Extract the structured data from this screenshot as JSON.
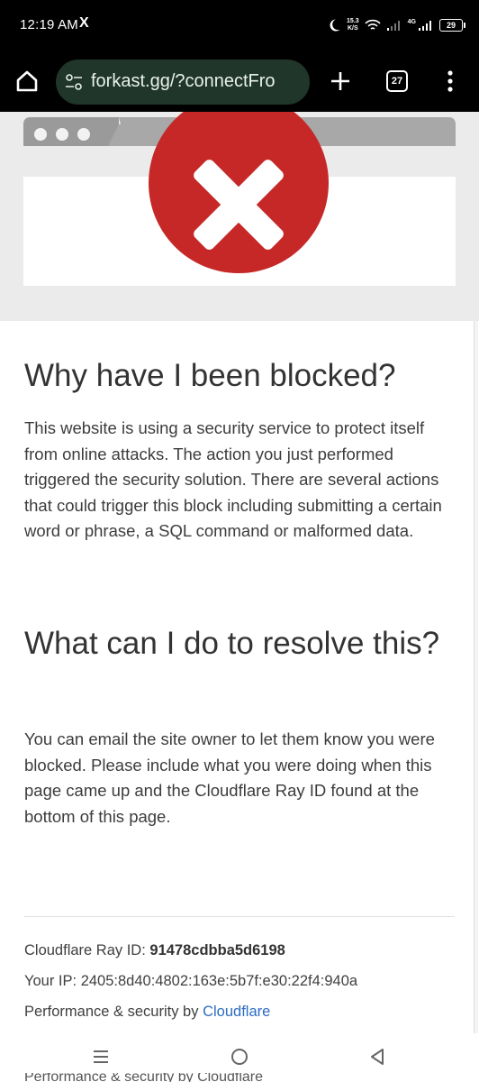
{
  "status_bar": {
    "time": "12:19 AM",
    "x_icon": "X",
    "net_speed_value": "15.3",
    "net_speed_unit": "K/S",
    "network_type": "4G",
    "battery": "29"
  },
  "browser": {
    "url": "forkast.gg/?connectFro",
    "tab_count": "27",
    "icons": [
      "home-icon",
      "site-settings-icon",
      "new-tab-icon",
      "tab-switcher-icon",
      "overflow-menu-icon"
    ]
  },
  "page": {
    "blocked_heading": "Why have I been blocked?",
    "blocked_body": "This website is using a security service to protect itself from online attacks. The action you just performed triggered the security solution. There are several actions that could trigger this block including submitting a certain word or phrase, a SQL command or malformed data.",
    "resolve_heading": "What can I do to resolve this?",
    "resolve_body": "You can email the site owner to let them know you were blocked. Please include what you were doing when this page came up and the Cloudflare Ray ID found at the bottom of this page.",
    "ray_label": "Cloudflare Ray ID:",
    "ray_id": "91478cdbba5d6198",
    "ip_label": "Your IP:",
    "ip_value": "2405:8d40:4802:163e:5b7f:e30:22f4:940a",
    "perf_label": "Performance & security by",
    "perf_link": "Cloudflare",
    "clipped_text": "Performance & security by Cloudflare"
  },
  "colors": {
    "error_red": "#c62828",
    "link_blue": "#2c6cc0",
    "urlbar_bg": "#20362a"
  }
}
